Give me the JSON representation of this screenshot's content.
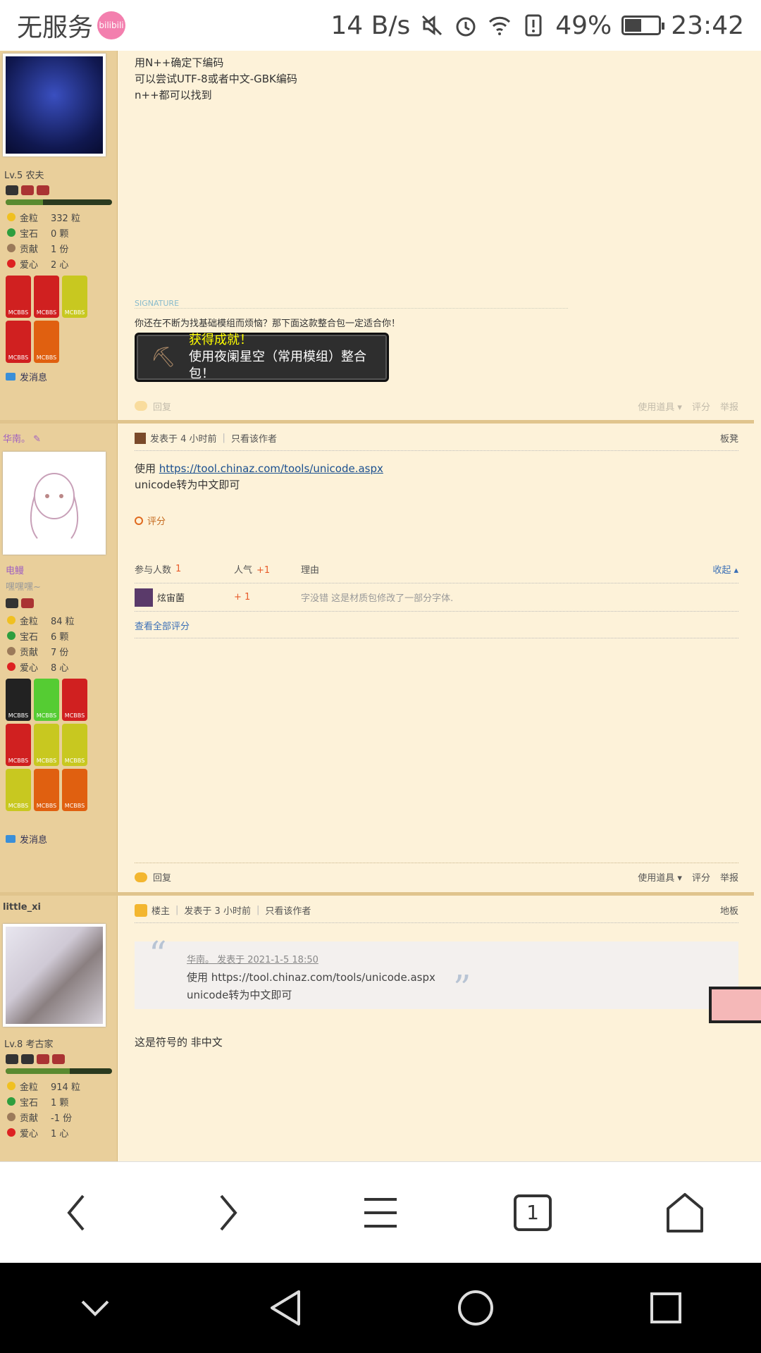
{
  "statusbar": {
    "carrier": "无服务",
    "bili": "bilibili",
    "speed": "14 B/s",
    "battery": "49%",
    "time": "23:42"
  },
  "post1": {
    "lines": [
      "用N++确定下编码",
      "可以尝试UTF-8或者中文-GBK编码",
      "n++都可以找到"
    ],
    "signature_label": "SIGNATURE",
    "signature_text": "你还在不断为找基础模组而烦恼？那下面这款整合包一定适合你！",
    "achievement_title": "获得成就！",
    "achievement_text": "使用夜阑星空（常用模组）整合包！",
    "reply": "回复",
    "tools": "使用道具",
    "rate": "评分",
    "report": "举报"
  },
  "user1": {
    "level": "Lv.5 农夫",
    "stats": [
      {
        "k": "金粒",
        "v": "332 粒",
        "c": "#f0c020"
      },
      {
        "k": "宝石",
        "v": "0 颗",
        "c": "#2e9e3e"
      },
      {
        "k": "贡献",
        "v": "1 份",
        "c": "#9b7a5a"
      },
      {
        "k": "爱心",
        "v": "2 心",
        "c": "#d22"
      }
    ],
    "message": "发消息",
    "exp": 0.35
  },
  "user2": {
    "name": "华南。",
    "title": "电鳗",
    "subtitle": "嘿嘿嘿~",
    "stats": [
      {
        "k": "金粒",
        "v": "84 粒",
        "c": "#f0c020"
      },
      {
        "k": "宝石",
        "v": "6 颗",
        "c": "#2e9e3e"
      },
      {
        "k": "贡献",
        "v": "7 份",
        "c": "#9b7a5a"
      },
      {
        "k": "爱心",
        "v": "8 心",
        "c": "#d22"
      }
    ],
    "message": "发消息"
  },
  "post2": {
    "meta": "发表于 4 小时前",
    "only_author": "只看该作者",
    "floor": "板凳",
    "text_prefix": "使用 ",
    "link": "https://tool.chinaz.com/tools/unicode.aspx",
    "text2": "unicode转为中文即可",
    "rating_label": "评分",
    "table_headers": {
      "participants": "参与人数",
      "participants_count": "1",
      "popularity": "人气",
      "popularity_count": "+1",
      "reason": "理由",
      "collapse": "收起"
    },
    "rating_row": {
      "user": "炫宙菌",
      "score": "+ 1",
      "reason": "字没错 这是材质包修改了一部分字体."
    },
    "view_all": "查看全部评分",
    "reply": "回复",
    "tools": "使用道具",
    "rate": "评分",
    "report": "举报"
  },
  "user3": {
    "name": "little_xi",
    "level": "Lv.8 考古家",
    "stats": [
      {
        "k": "金粒",
        "v": "914 粒",
        "c": "#f0c020"
      },
      {
        "k": "宝石",
        "v": "1 颗",
        "c": "#2e9e3e"
      },
      {
        "k": "贡献",
        "v": "-1 份",
        "c": "#9b7a5a"
      },
      {
        "k": "爱心",
        "v": "1 心",
        "c": "#d22"
      }
    ],
    "exp": 0.6
  },
  "post3": {
    "owner": "楼主",
    "meta": "发表于 3 小时前",
    "only_author": "只看该作者",
    "floor": "地板",
    "quote_src": "华南。 发表于 2021-1-5 18:50",
    "quote_line1": "使用 https://tool.chinaz.com/tools/unicode.aspx",
    "quote_line2": "unicode转为中文即可",
    "text": "这是符号的 非中文"
  },
  "navbar": {
    "tabs": "1"
  }
}
